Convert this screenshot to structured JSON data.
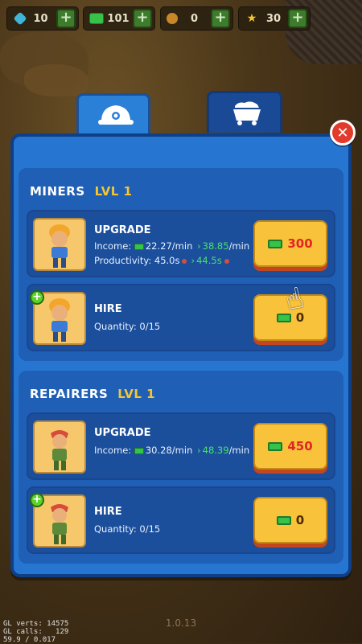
{
  "resources": [
    {
      "name": "gems",
      "icon": "gem-icon",
      "value": "10"
    },
    {
      "name": "cash",
      "icon": "cash-icon",
      "value": "101"
    },
    {
      "name": "coins",
      "icon": "coin-icon",
      "value": "0"
    },
    {
      "name": "stars",
      "icon": "star-icon",
      "value": "30"
    }
  ],
  "tabs": [
    {
      "name": "miners",
      "icon": "helmet-icon",
      "active": true
    },
    {
      "name": "carts",
      "icon": "mine-cart-icon",
      "active": false
    }
  ],
  "miners": {
    "title": "MINERS",
    "level": "LVL 1",
    "upgrade": {
      "title": "UPGRADE",
      "income_label": "Income:",
      "income_current": "22.27",
      "income_next": "38.85",
      "income_unit": "/min",
      "productivity_label": "Productivity:",
      "productivity_current": "45.0s",
      "productivity_next": "44.5s",
      "price": "300"
    },
    "hire": {
      "title": "HIRE",
      "quantity_label": "Quantity:",
      "quantity": "0/15",
      "price": "0"
    }
  },
  "repairers": {
    "title": "REPAIRERS",
    "level": "LVL 1",
    "upgrade": {
      "title": "UPGRADE",
      "income_label": "Income:",
      "income_current": "30.28",
      "income_next": "48.39",
      "income_unit": "/min",
      "price": "450"
    },
    "hire": {
      "title": "HIRE",
      "quantity_label": "Quantity:",
      "quantity": "0/15",
      "price": "0"
    }
  },
  "version": "1.0.13",
  "debug": {
    "gl_verts": "GL verts: 14575",
    "gl_calls": "GL calls:   129",
    "fps": "59.9 / 0.017"
  },
  "colors": {
    "panel": "#2676d1",
    "button": "#f9c23b",
    "price_red": "#e22424",
    "green_value": "#49e26b",
    "level_yellow": "#f7c62f"
  }
}
